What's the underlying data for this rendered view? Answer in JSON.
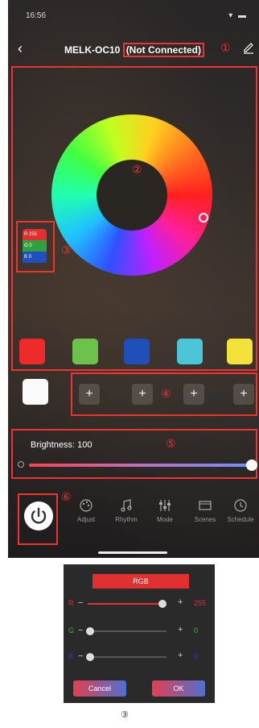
{
  "status_bar": {
    "time": "16:56",
    "icons": "▾ ▬"
  },
  "header": {
    "device_name": "MELK-OC10",
    "connection_status": "(Not Connected)",
    "callout_1": "①"
  },
  "callouts": {
    "c2": "②",
    "c3": "③",
    "c4": "④",
    "c5": "⑤",
    "c6": "⑥"
  },
  "rgb_mini": {
    "r_label": "R",
    "r_value": "255",
    "g_label": "G",
    "g_value": "0",
    "b_label": "B",
    "b_value": "0"
  },
  "swatches": [
    {
      "name": "red",
      "color": "#ee2b2b"
    },
    {
      "name": "green",
      "color": "#6cc24a"
    },
    {
      "name": "blue",
      "color": "#1f4fb8"
    },
    {
      "name": "cyan",
      "color": "#4cc6d6"
    },
    {
      "name": "yellow",
      "color": "#f2e23a"
    }
  ],
  "custom_slots": [
    "+",
    "+",
    "+",
    "+"
  ],
  "brightness": {
    "label": "Brightness: 100",
    "value": 100
  },
  "bottom_nav": [
    {
      "label": "Adjust",
      "icon": "palette-icon"
    },
    {
      "label": "Rhythm",
      "icon": "music-note-icon"
    },
    {
      "label": "Mode",
      "icon": "sliders-icon"
    },
    {
      "label": "Scenes",
      "icon": "film-icon"
    },
    {
      "label": "Schedule",
      "icon": "clock-icon"
    }
  ],
  "rgb_dialog": {
    "title": "RGB",
    "channels": [
      {
        "label": "R",
        "value": "255",
        "level": 1.0,
        "color": "#e03030"
      },
      {
        "label": "G",
        "value": "0",
        "level": 0.0,
        "color": "#30c030"
      },
      {
        "label": "B",
        "value": "0",
        "level": 0.0,
        "color": "#2040d0"
      }
    ],
    "minus": "−",
    "plus": "+",
    "cancel_label": "Cancel",
    "ok_label": "OK"
  },
  "caption": "③"
}
